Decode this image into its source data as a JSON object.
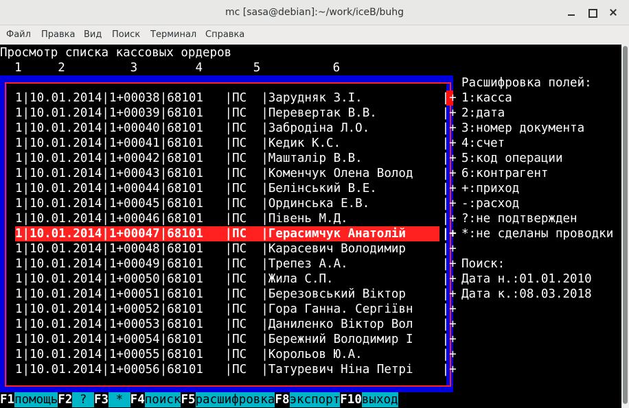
{
  "window": {
    "title": "mc [sasa@debian]:~/work/iceB/buhg"
  },
  "menu": [
    "Файл",
    "Правка",
    "Вид",
    "Поиск",
    "Терминал",
    "Справка"
  ],
  "screen": {
    "heading": "Просмотр списка кассовых ордеров",
    "column_numbers": "  1     2         3        4       5          6",
    "rows": [
      "1|10.01.2014|1+00038|68101   |ПС  |Зарудняк З.І.           |+",
      "1|10.01.2014|1+00039|68101   |ПС  |Перевертак В.В.         |+",
      "1|10.01.2014|1+00040|68101   |ПС  |Забродіна Л.О.          |+",
      "1|10.01.2014|1+00041|68101   |ПС  |Кедик К.С.              |+",
      "1|10.01.2014|1+00042|68101   |ПС  |Машталір В.В.           |+",
      "1|10.01.2014|1+00043|68101   |ПС  |Коменчук Олена Волод    |+",
      "1|10.01.2014|1+00044|68101   |ПС  |Белінський В.Е.         |+",
      "1|10.01.2014|1+00045|68101   |ПС  |Ординська Е.В.          |+",
      "1|10.01.2014|1+00046|68101   |ПС  |Півень М.Д.             |+",
      "1|10.01.2014|1+00047|68101   |ПС  |Герасимчук Анатолій     |+",
      "1|10.01.2014|1+00048|68101   |ПС  |Карасевич Володимир     |+",
      "1|10.01.2014|1+00049|68101   |ПС  |Трепез А.А.             |+",
      "1|10.01.2014|1+00050|68101   |ПС  |Жила С.П.               |+",
      "1|10.01.2014|1+00051|68101   |ПС  |Березовський Віктор     |+",
      "1|10.01.2014|1+00052|68101   |ПС  |Гора Ганна. Сергіївн    |+",
      "1|10.01.2014|1+00053|68101   |ПС  |Даниленко Віктор Вол    |+",
      "1|10.01.2014|1+00054|68101   |ПС  |Бережний Володимир І    |+",
      "1|10.01.2014|1+00055|68101   |ПС  |Корольов Ю.А.           |+",
      "1|10.01.2014|1+00056|68101   |ПС  |Татуревич Ніна Петрі    |+"
    ],
    "selected_index": 9,
    "legend": [
      "Расшифровка полей:",
      "1:касса",
      "2:дата",
      "3:номер документа",
      "4:счет",
      "5:код операции",
      "6:контрагент",
      "+:приход",
      "-:расход",
      "?:не подтвержден",
      "*:не сделаны проводки",
      "",
      "Поиск:",
      "Дата н.:01.01.2010",
      "Дата к.:08.03.2018"
    ],
    "fkeys": [
      {
        "key": "F1",
        "label": "помощь"
      },
      {
        "key": "F2",
        "label": " ? "
      },
      {
        "key": "F3",
        "label": " * "
      },
      {
        "key": "F4",
        "label": "поиск"
      },
      {
        "key": "F5",
        "label": "расшифровка"
      },
      {
        "key": "F8",
        "label": "экспорт"
      },
      {
        "key": "F10",
        "label": "выход"
      }
    ]
  }
}
